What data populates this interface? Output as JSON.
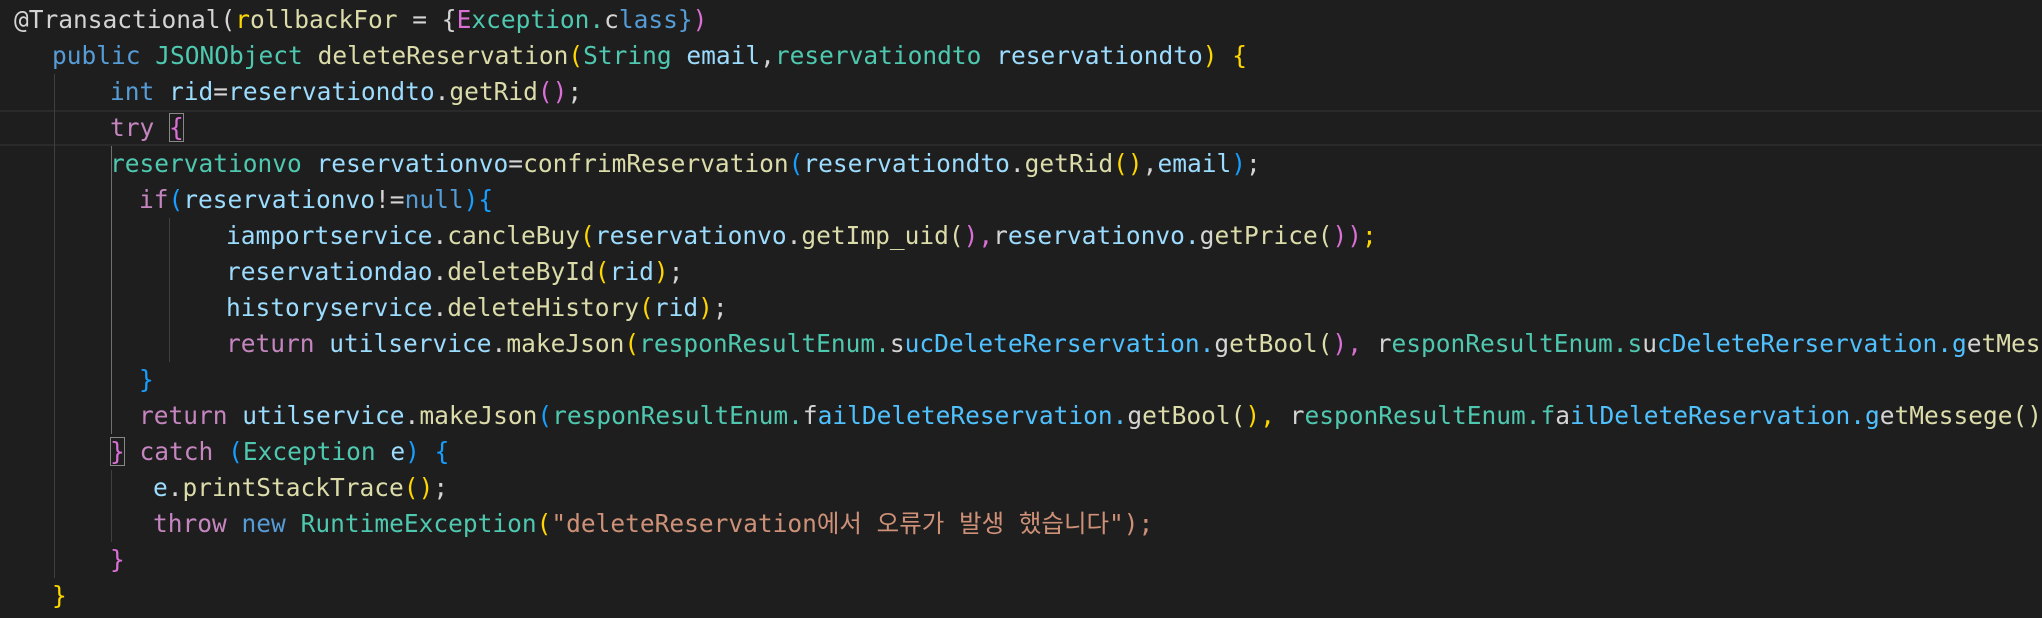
{
  "editor": {
    "language": "java",
    "colors": {
      "background": "#1e1e1e",
      "keyword": "#569cd6",
      "control_keyword": "#c586c0",
      "type": "#4ec9b0",
      "function": "#dcdcaa",
      "variable": "#9cdcfe",
      "property": "#4fc1ff",
      "string": "#ce9178",
      "bracket_level_1": "#ffd700",
      "bracket_level_2": "#da70d6",
      "bracket_level_3": "#179fff"
    },
    "lines": [
      {
        "text": "@Transactional(rollbackFor = {Exception.class})"
      },
      {
        "text": "public JSONObject deleteReservation(String email,reservationdto reservationdto) {"
      },
      {
        "text": "int rid=reservationdto.getRid();"
      },
      {
        "text": "try {"
      },
      {
        "text": "reservationvo reservationvo=confrimReservation(reservationdto.getRid(),email);"
      },
      {
        "text": "if(reservationvo!=null){"
      },
      {
        "text": "iamportservice.cancleBuy(reservationvo.getImp_uid(),reservationvo.getPrice());"
      },
      {
        "text": "reservationdao.deleteById(rid);"
      },
      {
        "text": "historyservice.deleteHistory(rid);"
      },
      {
        "text": "return utilservice.makeJson(responResultEnum.sucDeleteRerservation.getBool(), responResultEnum.sucDeleteRerservation.getMessege"
      },
      {
        "text": "}"
      },
      {
        "text": "return utilservice.makeJson(responResultEnum.failDeleteReservation.getBool(), responResultEnum.failDeleteReservation.getMessege());"
      },
      {
        "text": "} catch (Exception e) {"
      },
      {
        "text": "e.printStackTrace();"
      },
      {
        "text": "throw new RuntimeException(\"deleteReservation에서 오류가 발생 했습니다\");"
      },
      {
        "text": "}"
      },
      {
        "text": "}"
      }
    ]
  }
}
